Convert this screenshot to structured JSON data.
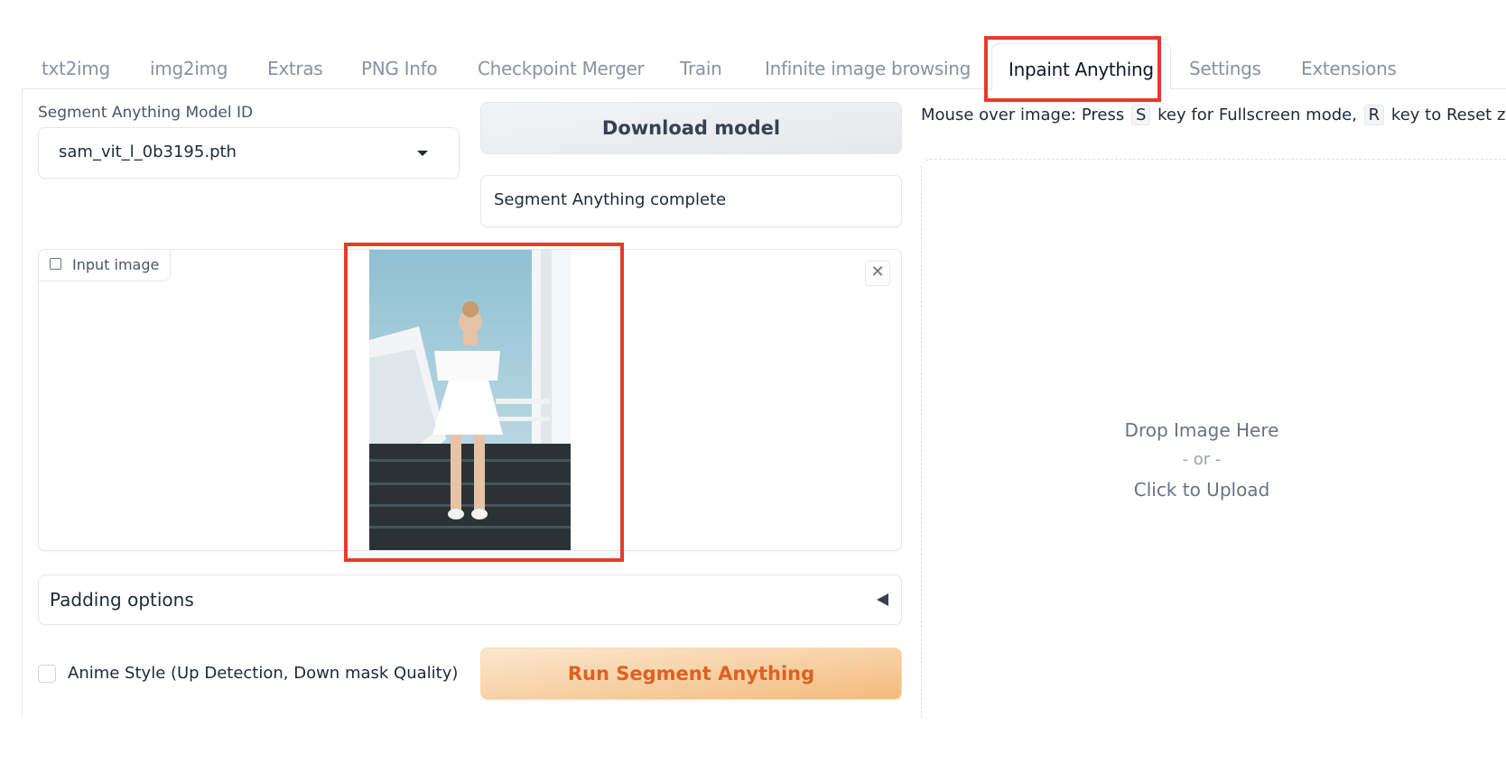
{
  "tabs": [
    {
      "label": "txt2img",
      "active": false
    },
    {
      "label": "img2img",
      "active": false
    },
    {
      "label": "Extras",
      "active": false
    },
    {
      "label": "PNG Info",
      "active": false
    },
    {
      "label": "Checkpoint Merger",
      "active": false
    },
    {
      "label": "Train",
      "active": false
    },
    {
      "label": "Infinite image browsing",
      "active": false
    },
    {
      "label": "Inpaint Anything",
      "active": true
    },
    {
      "label": "Settings",
      "active": false
    },
    {
      "label": "Extensions",
      "active": false
    }
  ],
  "model": {
    "label": "Segment Anything Model ID",
    "selected": "sam_vit_l_0b3195.pth"
  },
  "download_button": "Download model",
  "status": "Segment Anything complete",
  "input_image": {
    "label": "Input image",
    "icon": "image-icon",
    "close_icon": "close-icon",
    "alt": "Woman in white off-shoulder dress walking down dark stairs"
  },
  "padding_options": {
    "label": "Padding options",
    "icon": "triangle-left-icon"
  },
  "anime_style": {
    "label": "Anime Style (Up Detection, Down mask Quality)",
    "checked": false
  },
  "run_button": "Run Segment Anything",
  "hint": {
    "prefix": "Mouse over image: Press",
    "key1": "S",
    "middle": "key for Fullscreen mode,",
    "key2": "R",
    "suffix": "key to Reset zoom"
  },
  "drop_zone": {
    "line1": "Drop Image Here",
    "line2": "- or -",
    "line3": "Click to Upload"
  },
  "colors": {
    "highlight": "#e8392a",
    "primary_text": "#e0601f"
  }
}
